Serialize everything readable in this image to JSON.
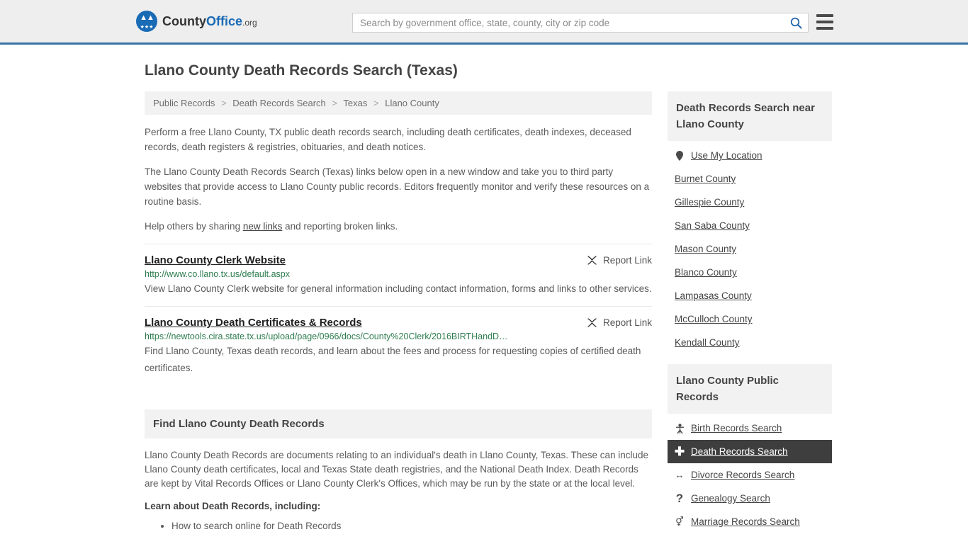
{
  "header": {
    "logo": {
      "text_part1": "County",
      "text_part2": "Office",
      "text_part3": ".org",
      "eagle_glyph": "ὔ",
      "stars_glyph": "★★★"
    },
    "search": {
      "placeholder": "Search by government office, state, county, city or zip code",
      "value": "",
      "search_icon": "search-icon"
    },
    "menu_icon": "hamburger-menu-icon"
  },
  "page_title": "Llano County Death Records Search (Texas)",
  "breadcrumb": {
    "separator": ">",
    "items": [
      {
        "label": "Public Records"
      },
      {
        "label": "Death Records Search"
      },
      {
        "label": "Texas"
      },
      {
        "label": "Llano County"
      }
    ]
  },
  "intro": {
    "paragraph1": "Perform a free Llano County, TX public death records search, including death certificates, death indexes, deceased records, death registers & registries, obituaries, and death notices.",
    "paragraph2": "The Llano County Death Records Search (Texas) links below open in a new window and take you to third party websites that provide access to Llano County public records. Editors frequently monitor and verify these resources on a routine basis.",
    "paragraph3_before": "Help others by sharing ",
    "paragraph3_link": "new links",
    "paragraph3_after": " and reporting broken links."
  },
  "results": [
    {
      "title": "Llano County Clerk Website",
      "url": "http://www.co.llano.tx.us/default.aspx",
      "description": "View Llano County Clerk website for general information including contact information, forms and links to other services.",
      "report_label": "Report Link",
      "report_icon": "broken-link-icon"
    },
    {
      "title": "Llano County Death Certificates & Records",
      "url": "https://newtools.cira.state.tx.us/upload/page/0966/docs/County%20Clerk/2016BIRTHandD…",
      "description": "Find Llano County, Texas death records, and learn about the fees and process for requesting copies of certified death certificates.",
      "report_label": "Report Link",
      "report_icon": "broken-link-icon"
    }
  ],
  "find_section": {
    "heading": "Find Llano County Death Records",
    "body": "Llano County Death Records are documents relating to an individual's death in Llano County, Texas. These can include Llano County death certificates, local and Texas State death registries, and the National Death Index. Death Records are kept by Vital Records Offices or Llano County Clerk's Offices, which may be run by the state or at the local level.",
    "learn_heading": "Learn about Death Records, including:",
    "topics": [
      "How to search online for Death Records"
    ]
  },
  "sidebar": {
    "near_card": {
      "heading": "Death Records Search near Llano County",
      "items": [
        {
          "label": "Use My Location",
          "icon": "map-pin-icon",
          "glyph": "•"
        },
        {
          "label": "Burnet County",
          "icon": "",
          "glyph": ""
        },
        {
          "label": "Gillespie County",
          "icon": "",
          "glyph": ""
        },
        {
          "label": "San Saba County",
          "icon": "",
          "glyph": ""
        },
        {
          "label": "Mason County",
          "icon": "",
          "glyph": ""
        },
        {
          "label": "Blanco County",
          "icon": "",
          "glyph": ""
        },
        {
          "label": "Lampasas County",
          "icon": "",
          "glyph": ""
        },
        {
          "label": "McCulloch County",
          "icon": "",
          "glyph": ""
        },
        {
          "label": "Kendall County",
          "icon": "",
          "glyph": ""
        }
      ]
    },
    "public_records_card": {
      "heading": "Llano County Public Records",
      "items": [
        {
          "label": "Birth Records Search",
          "icon": "baby-icon",
          "glyph": "Ɣ",
          "active": false
        },
        {
          "label": "Death Records Search",
          "icon": "cross-plus-icon",
          "glyph": "✚",
          "active": true
        },
        {
          "label": "Divorce Records Search",
          "icon": "left-right-arrow-icon",
          "glyph": "↔",
          "active": false
        },
        {
          "label": "Genealogy Search",
          "icon": "question-mark-icon",
          "glyph": "?",
          "active": false
        },
        {
          "label": "Marriage Records Search",
          "icon": "male-female-icon",
          "glyph": "⚥",
          "active": false
        }
      ]
    }
  },
  "colors": {
    "header_bg": "#eeeeee",
    "header_border": "#3973a5",
    "brand_blue": "#1a6bb5",
    "panel_bg": "#f2f2f2",
    "url_green": "#2e7d4f",
    "active_bg": "#3e3e3e",
    "text": "#5a5a5a"
  }
}
